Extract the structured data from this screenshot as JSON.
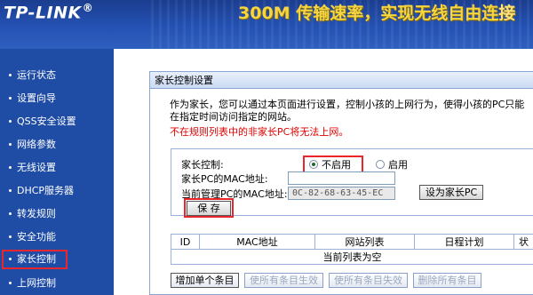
{
  "header": {
    "logo": "TP-LINK",
    "logo_mark": "®",
    "tagline_main": "300M",
    "tagline_text": "传输速率，实现无线自由连",
    "tagline_rest": "接"
  },
  "sidebar": {
    "items": [
      {
        "label": "运行状态"
      },
      {
        "label": "设置向导"
      },
      {
        "label": "QSS安全设置"
      },
      {
        "label": "网络参数"
      },
      {
        "label": "无线设置"
      },
      {
        "label": "DHCP服务器"
      },
      {
        "label": "转发规则"
      },
      {
        "label": "安全功能"
      },
      {
        "label": "家长控制"
      },
      {
        "label": "上网控制"
      }
    ],
    "active_index": 8
  },
  "panel": {
    "title": "家长控制设置",
    "description": "作为家长，您可以通过本页面进行设置，控制小孩的上网行为，使得小孩的PC只能在指定时间访问指定的网站。",
    "warning": "不在规则列表中的非家长PC将无法上网。",
    "form": {
      "control_label": "家长控制:",
      "option_off": "不启用",
      "option_on": "启用",
      "selected": "不启用",
      "parent_mac_label": "家长PC的MAC地址:",
      "parent_mac_value": "",
      "current_mac_label": "当前管理PC的MAC地址:",
      "current_mac_value": "0C-82-68-63-45-EC",
      "set_parent_button": "设为家长PC",
      "save_button": "保 存"
    },
    "table": {
      "headers": [
        "ID",
        "MAC地址",
        "网站列表",
        "日程计划",
        "状"
      ],
      "empty_text": "当前列表为空"
    },
    "actions": {
      "add": "增加单个条目",
      "enable_all": "使所有条目生效",
      "disable_all": "使所有条目失效",
      "delete_all": "删除所有条目"
    }
  },
  "colors": {
    "header_blue": "#1b3d8f",
    "sidebar_blue": "#1f4da6",
    "highlight_red": "#e8262b",
    "warning_red": "#e00000",
    "tagline_yellow": "#f5d542"
  }
}
